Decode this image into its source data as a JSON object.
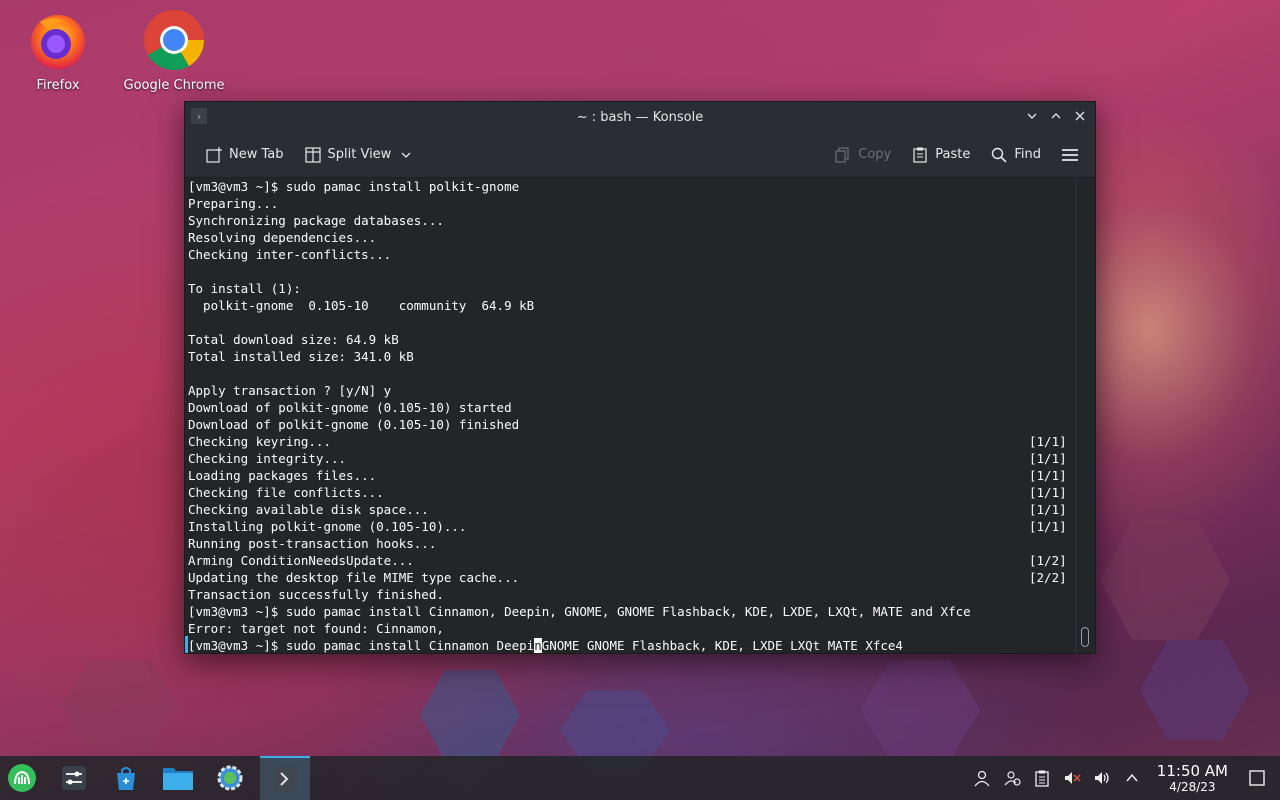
{
  "desktop": {
    "icons": [
      {
        "label": "Firefox"
      },
      {
        "label": "Google Chrome"
      }
    ]
  },
  "window": {
    "title": "~ : bash — Konsole"
  },
  "toolbar": {
    "new_tab": "New Tab",
    "split_view": "Split View",
    "copy": "Copy",
    "paste": "Paste",
    "find": "Find"
  },
  "terminal": {
    "lines": [
      {
        "text": "[vm3@vm3 ~]$ sudo pamac install polkit-gnome",
        "right": ""
      },
      {
        "text": "Preparing...",
        "right": ""
      },
      {
        "text": "Synchronizing package databases...",
        "right": ""
      },
      {
        "text": "Resolving dependencies...",
        "right": ""
      },
      {
        "text": "Checking inter-conflicts...",
        "right": ""
      },
      {
        "text": "",
        "right": ""
      },
      {
        "text": "To install (1):",
        "right": ""
      },
      {
        "text": "  polkit-gnome  0.105-10    community  64.9 kB",
        "right": ""
      },
      {
        "text": "",
        "right": ""
      },
      {
        "text": "Total download size: 64.9 kB",
        "right": ""
      },
      {
        "text": "Total installed size: 341.0 kB",
        "right": ""
      },
      {
        "text": "",
        "right": ""
      },
      {
        "text": "Apply transaction ? [y/N] y",
        "right": ""
      },
      {
        "text": "Download of polkit-gnome (0.105-10) started",
        "right": ""
      },
      {
        "text": "Download of polkit-gnome (0.105-10) finished",
        "right": ""
      },
      {
        "text": "Checking keyring...",
        "right": "[1/1]"
      },
      {
        "text": "Checking integrity...",
        "right": "[1/1]"
      },
      {
        "text": "Loading packages files...",
        "right": "[1/1]"
      },
      {
        "text": "Checking file conflicts...",
        "right": "[1/1]"
      },
      {
        "text": "Checking available disk space...",
        "right": "[1/1]"
      },
      {
        "text": "Installing polkit-gnome (0.105-10)...",
        "right": "[1/1]"
      },
      {
        "text": "Running post-transaction hooks...",
        "right": ""
      },
      {
        "text": "Arming ConditionNeedsUpdate...",
        "right": "[1/2]"
      },
      {
        "text": "Updating the desktop file MIME type cache...",
        "right": "[2/2]"
      },
      {
        "text": "Transaction successfully finished.",
        "right": ""
      },
      {
        "text": "[vm3@vm3 ~]$ sudo pamac install Cinnamon, Deepin, GNOME, GNOME Flashback, KDE, LXDE, LXQt, MATE and Xfce",
        "right": ""
      },
      {
        "text": "Error: target not found: Cinnamon,",
        "right": ""
      }
    ],
    "prompt_before_cursor": "[vm3@vm3 ~]$ sudo pamac install Cinnamon Deepi",
    "cursor_char": "n",
    "prompt_after_cursor": "GNOME GNOME Flashback, KDE, LXDE LXQt MATE Xfce4"
  },
  "taskbar": {
    "clock_time": "11:50 AM",
    "clock_date": "4/28/23"
  },
  "colors": {
    "accent": "#3daee9",
    "terminal_bg": "#232629",
    "terminal_fg": "#fcfcfc"
  }
}
